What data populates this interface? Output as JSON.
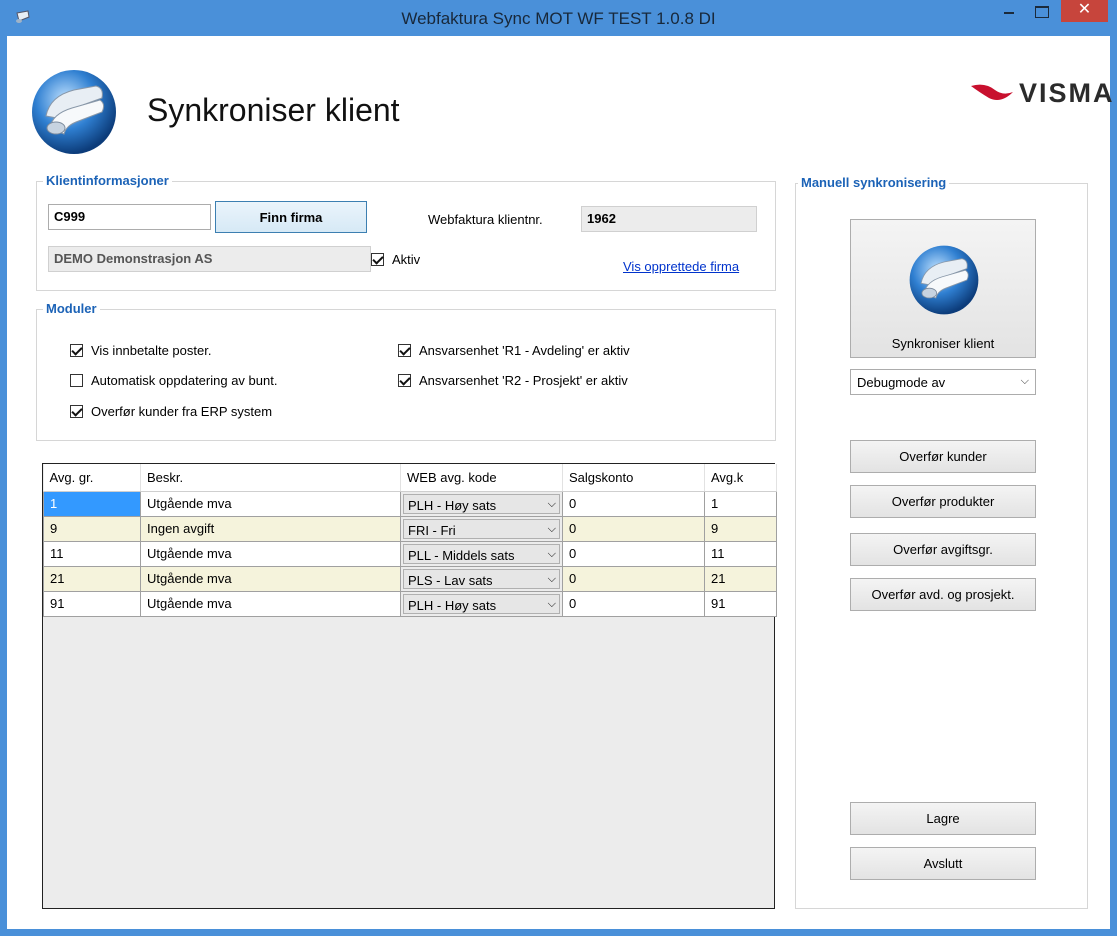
{
  "window": {
    "title": "Webfaktura Sync MOT WF TEST 1.0.8 DI",
    "close_glyph": "✕"
  },
  "header": {
    "title": "Synkroniser klient",
    "brand": "VISMA"
  },
  "klient": {
    "legend": "Klientinformasjoner",
    "client_code": "C999",
    "find_button": "Finn firma",
    "webfaktura_label": "Webfaktura klientnr.",
    "webfaktura_value": "1962",
    "company_name": "DEMO Demonstrasjon AS",
    "aktiv_label": "Aktiv",
    "aktiv_checked": true,
    "link": "Vis opprettede firma"
  },
  "moduler": {
    "legend": "Moduler",
    "options": [
      {
        "label": "Vis innbetalte poster.",
        "checked": true
      },
      {
        "label": "Automatisk oppdatering av bunt.",
        "checked": false
      },
      {
        "label": "Overfør kunder fra ERP system",
        "checked": true
      },
      {
        "label": "Ansvarsenhet 'R1 - Avdeling' er aktiv",
        "checked": true
      },
      {
        "label": "Ansvarsenhet 'R2 - Prosjekt' er aktiv",
        "checked": true
      }
    ]
  },
  "grid": {
    "columns": [
      "Avg. gr.",
      "Beskr.",
      "WEB avg. kode",
      "Salgskonto",
      "Avg.k"
    ],
    "rows": [
      {
        "gr": "1",
        "beskr": "Utgående mva",
        "kode": "PLH - Høy sats",
        "konto": "0",
        "avgk": "1"
      },
      {
        "gr": "9",
        "beskr": "Ingen avgift",
        "kode": "FRI - Fri",
        "konto": "0",
        "avgk": "9"
      },
      {
        "gr": "11",
        "beskr": "Utgående mva",
        "kode": "PLL - Middels sats",
        "konto": "0",
        "avgk": "11"
      },
      {
        "gr": "21",
        "beskr": "Utgående mva",
        "kode": "PLS - Lav sats",
        "konto": "0",
        "avgk": "21"
      },
      {
        "gr": "91",
        "beskr": "Utgående mva",
        "kode": "PLH - Høy sats",
        "konto": "0",
        "avgk": "91"
      }
    ]
  },
  "manuell": {
    "legend": "Manuell synkronisering",
    "sync_button": "Synkroniser klient",
    "debug_select": "Debugmode av",
    "buttons": {
      "kunder": "Overfør kunder",
      "produkter": "Overfør produkter",
      "avgiftsgr": "Overfør avgiftsgr.",
      "avd": "Overfør avd. og prosjekt."
    },
    "lagre": "Lagre",
    "avslutt": "Avslutt"
  },
  "colors": {
    "titlebar": "#4a90d9",
    "legend": "#1c63b7",
    "selected_cell": "#3399ff",
    "alt_row": "#f5f3dc",
    "visma_red": "#c8102e"
  },
  "icons": {
    "app": "paper-roll-icon",
    "sync": "paper-roll-icon",
    "brand": "visma-logo"
  }
}
